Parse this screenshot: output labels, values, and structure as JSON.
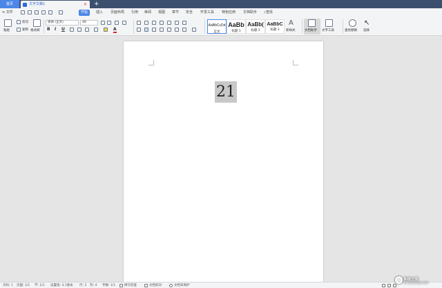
{
  "tabs": {
    "home": "首页",
    "doc_title": "文字文稿1",
    "close": "×",
    "plus": "+"
  },
  "menu": {
    "file": "≡ 文件",
    "items": [
      "开始",
      "插入",
      "页面布局",
      "引用",
      "审阅",
      "视图",
      "章节",
      "安全",
      "开发工具",
      "特色应用",
      "文档助手"
    ],
    "search": "查找"
  },
  "ribbon": {
    "paste": "粘贴",
    "cut": "剪切",
    "copy": "复制",
    "format_painter": "格式刷",
    "font_name": "宋体 (正文)",
    "font_size": "48",
    "bold": "B",
    "italic": "I",
    "underline": "U",
    "font_color": "A",
    "styles": [
      {
        "sample": "AaBbCcDd",
        "name": "正文"
      },
      {
        "sample": "AaBb",
        "name": "标题 1"
      },
      {
        "sample": "AaBb(",
        "name": "标题 2"
      },
      {
        "sample": "AaBbC",
        "name": "标题 3"
      }
    ],
    "new_style": "新样式",
    "doc_assistant": "文档助手",
    "text_tools": "文字工具",
    "find_replace": "查找替换",
    "select": "选择"
  },
  "document": {
    "text": "21"
  },
  "status": {
    "page_num": "页码: 1",
    "pages": "页面: 1/1",
    "section": "节: 1/1",
    "setting": "设置值: 4.1厘米",
    "row": "行: 2",
    "col": "列: 4",
    "word_count": "字数: 1/1",
    "spell_check": "拼写检查",
    "doc_proof": "文档校对",
    "protect": "文档未保护"
  },
  "watermark": {
    "text": "系统之家",
    "url": "XITONGZHIJIA.NET"
  },
  "colors": {
    "accent": "#4b86e8",
    "tabbar": "#3d4f6e",
    "selection": "#c8c8c8"
  }
}
